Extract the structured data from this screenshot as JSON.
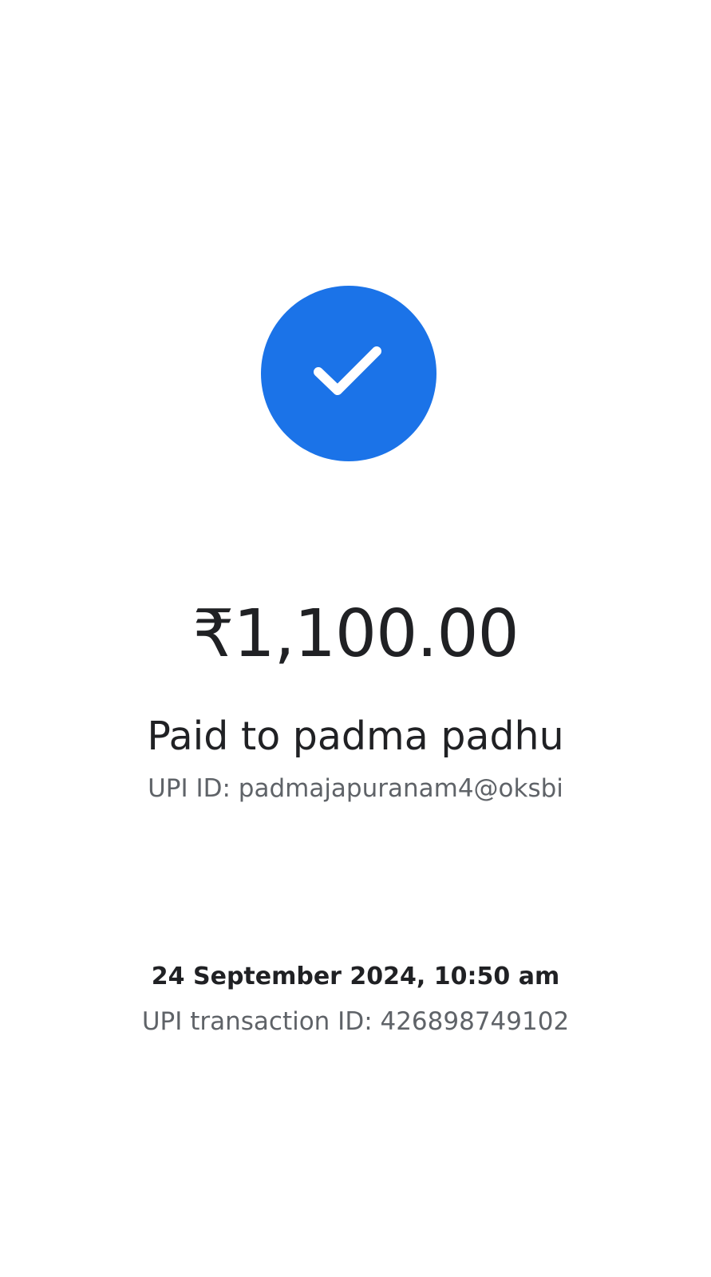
{
  "payment": {
    "status_icon": "check-icon",
    "accent_color": "#1b73e8",
    "amount": "₹1,100.00",
    "recipient_line": "Paid to padma padhu",
    "upi_id_line": "UPI ID: padmajapuranam4@oksbi",
    "datetime": "24 September 2024, 10:50 am",
    "transaction_id_line": "UPI transaction ID: 426898749102"
  }
}
